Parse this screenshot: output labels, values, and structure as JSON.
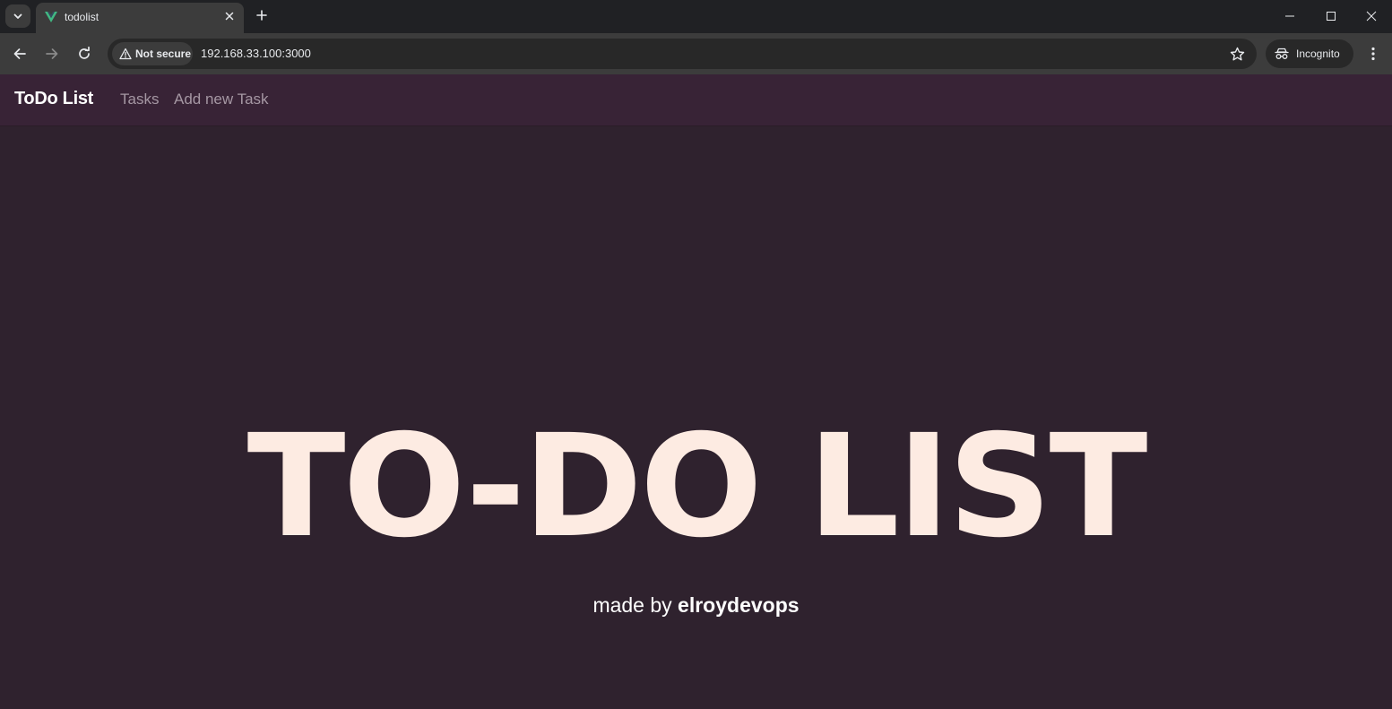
{
  "browser": {
    "tab": {
      "title": "todolist",
      "favicon": "vue-logo-icon"
    },
    "security_label": "Not secure",
    "url": "192.168.33.100:3000",
    "incognito_label": "Incognito",
    "colors": {
      "frame": "#202124",
      "toolbar": "#3c3c3c",
      "omnibox": "#282828",
      "vue_green": "#41b883"
    }
  },
  "navbar": {
    "brand": "ToDo List",
    "links": [
      {
        "label": "Tasks"
      },
      {
        "label": "Add new Task"
      }
    ],
    "colors": {
      "background": "#382336",
      "link": "#a597a3"
    }
  },
  "hero": {
    "title": "TO-DO LIST",
    "made_by_prefix": "made by",
    "author": "elroydevops",
    "colors": {
      "background": "#2f222e",
      "title": "#fdebe2"
    }
  }
}
